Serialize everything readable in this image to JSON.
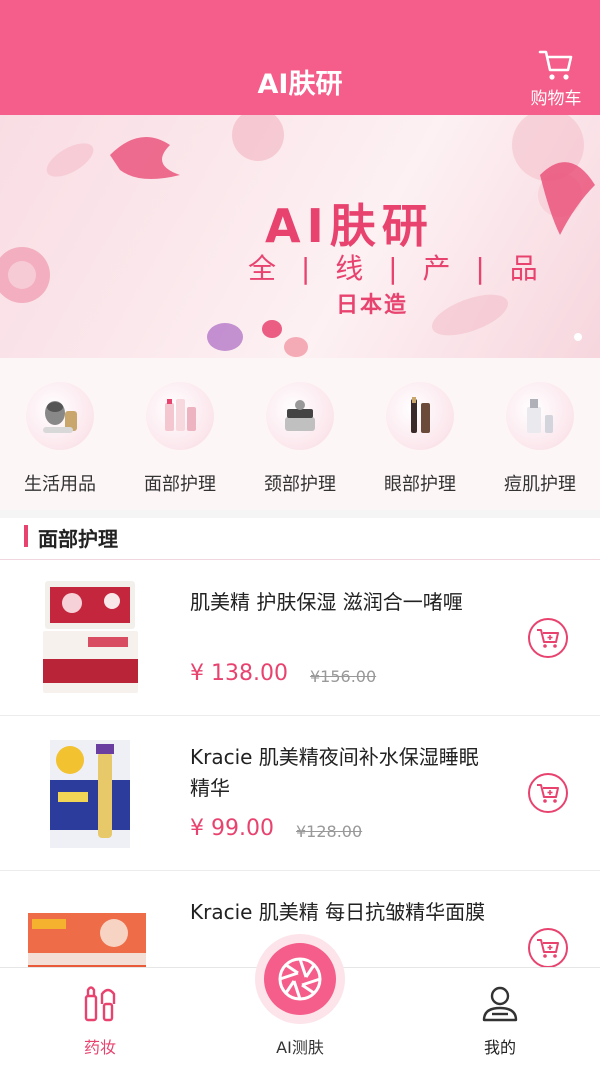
{
  "header": {
    "title": "AI肤研",
    "cart_label": "购物车"
  },
  "banner": {
    "title": "AI肤研",
    "subtitle": "全 | 线 | 产 | 品",
    "made_in": "日本造"
  },
  "categories": [
    {
      "label": "生活用品"
    },
    {
      "label": "面部护理"
    },
    {
      "label": "颈部护理"
    },
    {
      "label": "眼部护理"
    },
    {
      "label": "痘肌护理"
    }
  ],
  "section": {
    "title": "面部护理"
  },
  "products": [
    {
      "name": "肌美精 护肤保湿 滋润合一啫喱",
      "price": "¥ 138.00",
      "original_price": "¥156.00"
    },
    {
      "name": "Kracie 肌美精夜间补水保湿睡眠精华",
      "price": "¥ 99.00",
      "original_price": "¥128.00"
    },
    {
      "name": "Kracie 肌美精 每日抗皱精华面膜",
      "price": "",
      "original_price": ""
    }
  ],
  "tabbar": {
    "makeup": "药妆",
    "ai_scan": "AI测肤",
    "mine": "我的"
  },
  "colors": {
    "brand": "#f55d8a",
    "accent": "#e8436f"
  }
}
